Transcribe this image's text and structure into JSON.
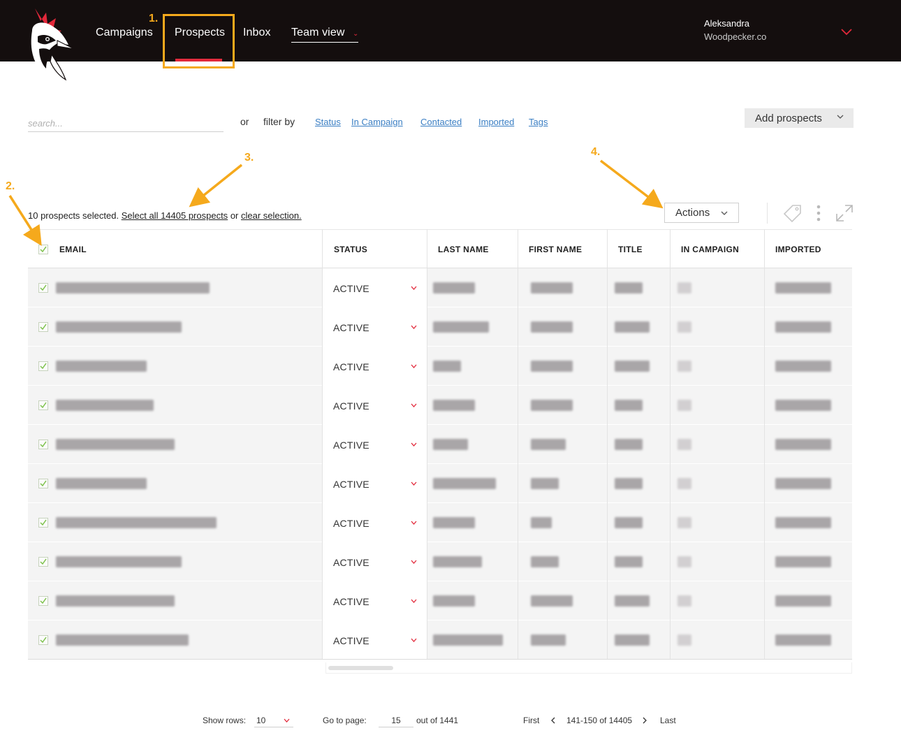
{
  "nav": {
    "items": [
      {
        "label": "Campaigns"
      },
      {
        "label": "Prospects"
      },
      {
        "label": "Inbox"
      },
      {
        "label": "Team view"
      }
    ],
    "active": "Prospects",
    "user_name": "Aleksandra",
    "user_company": "Woodpecker.co"
  },
  "annotations": {
    "n1": "1.",
    "n2": "2.",
    "n3": "3.",
    "n4": "4.",
    "color": "#f5a91c"
  },
  "search": {
    "placeholder": "search...",
    "or_label": "or",
    "filter_label": "filter by",
    "filters": [
      "Status",
      "In Campaign",
      "Contacted",
      "Imported",
      "Tags"
    ]
  },
  "add_prospects_label": "Add prospects",
  "selection": {
    "prefix": "10 prospects selected.",
    "select_all": "Select all 14405 prospects",
    "or": "or",
    "clear": "clear selection."
  },
  "actions_label": "Actions",
  "table": {
    "columns": [
      "EMAIL",
      "STATUS",
      "LAST NAME",
      "FIRST NAME",
      "TITLE",
      "IN CAMPAIGN",
      "IMPORTED"
    ],
    "rows": [
      {
        "checked": true,
        "status": "ACTIVE"
      },
      {
        "checked": true,
        "status": "ACTIVE"
      },
      {
        "checked": true,
        "status": "ACTIVE"
      },
      {
        "checked": true,
        "status": "ACTIVE"
      },
      {
        "checked": true,
        "status": "ACTIVE"
      },
      {
        "checked": true,
        "status": "ACTIVE"
      },
      {
        "checked": true,
        "status": "ACTIVE"
      },
      {
        "checked": true,
        "status": "ACTIVE"
      },
      {
        "checked": true,
        "status": "ACTIVE"
      },
      {
        "checked": true,
        "status": "ACTIVE"
      }
    ]
  },
  "pagination": {
    "show_rows_label": "Show rows:",
    "show_rows_value": "10",
    "go_to_label": "Go to page:",
    "page_value": "15",
    "out_of": "out of 1441",
    "first": "First",
    "range": "141-150 of 14405",
    "last": "Last"
  },
  "colors": {
    "topbar": "#140e0e",
    "accent_red": "#e2283a",
    "link_blue": "#3b7fc4",
    "annotation_orange": "#f5a91c",
    "check_green": "#7dc24b"
  }
}
